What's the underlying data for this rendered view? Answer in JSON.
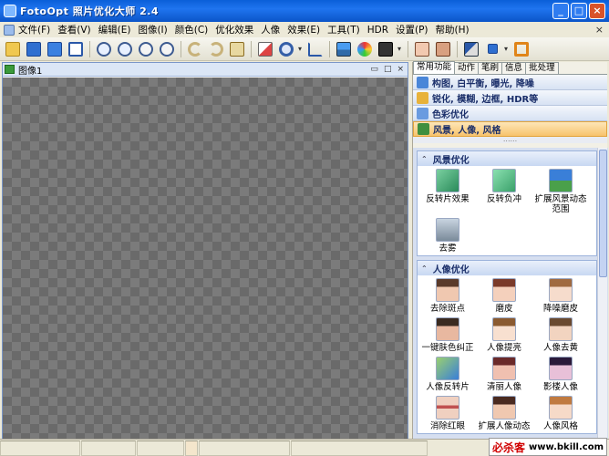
{
  "window": {
    "title": "FotoOpt 照片优化大师 2.4",
    "minimize": "_",
    "maximize": "□",
    "close": "×"
  },
  "menu": {
    "items": [
      "文件(F)",
      "查看(V)",
      "编辑(E)",
      "图像(I)",
      "颜色(C)",
      "优化效果",
      "人像",
      "效果(E)",
      "工具(T)",
      "HDR",
      "设置(P)",
      "帮助(H)"
    ],
    "close": "×"
  },
  "toolbar": {
    "icons": [
      "open-icon",
      "save-icon",
      "save-as-icon",
      "window-icon",
      "zoom-in-icon",
      "zoom-out-icon",
      "fit-icon",
      "actual-size-icon",
      "undo-icon",
      "redo-icon",
      "history-icon",
      "resize-icon",
      "rotate-icon",
      "crop-icon",
      "landscape-icon",
      "color-wheel-icon",
      "filmstrip-icon",
      "portrait-a-icon",
      "portrait-b-icon",
      "brush-icon",
      "save-small-icon",
      "frame-icon"
    ]
  },
  "document": {
    "title": "图像1",
    "btn_restore": "▭",
    "btn_max": "□",
    "btn_close": "×"
  },
  "panel": {
    "tabs": [
      "常用功能",
      "动作",
      "笔刷",
      "信息",
      "批处理"
    ],
    "active_tab": 0,
    "categories": [
      {
        "label": "构图, 白平衡, 曝光, 降噪",
        "color": "#4a86d8"
      },
      {
        "label": "锐化, 模糊, 边框, HDR等",
        "color": "#e8b23a"
      },
      {
        "label": "色彩优化",
        "color": "#6a9be0"
      },
      {
        "label": "风景, 人像, 风格",
        "color": "#3f8f3f"
      }
    ],
    "grip": "......",
    "sections": [
      {
        "title": "风景优化",
        "items": [
          "反转片效果",
          "反转负冲",
          "扩展风景动态范围",
          "去雾"
        ]
      },
      {
        "title": "人像优化",
        "items": [
          "去除斑点",
          "磨皮",
          "降噪磨皮",
          "一键肤色纠正",
          "人像提亮",
          "人像去黄",
          "人像反转片",
          "清丽人像",
          "影楼人像",
          "消除红眼",
          "扩展人像动态",
          "人像风格"
        ]
      }
    ]
  },
  "watermark": {
    "brand": "必杀客",
    "url": "www.bkill.com"
  }
}
